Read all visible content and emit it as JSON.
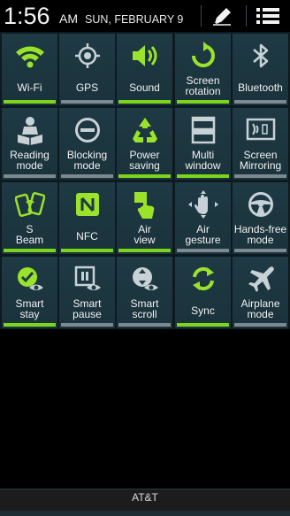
{
  "status": {
    "time": "1:56",
    "ampm": "AM",
    "date": "SUN, FEBRUARY 9"
  },
  "header_icons": {
    "edit": "pencil-icon",
    "list": "list-menu-icon"
  },
  "colors": {
    "active_green": "#7ad51c",
    "inactive_gray": "#7c8990",
    "tile_bg": "#1e3a44"
  },
  "quick_settings": [
    {
      "label": "Wi-Fi",
      "icon": "wifi-icon",
      "on": true
    },
    {
      "label": "GPS",
      "icon": "gps-icon",
      "on": false
    },
    {
      "label": "Sound",
      "icon": "sound-icon",
      "on": true
    },
    {
      "label": "Screen rotation",
      "icon": "screen-rotation-icon",
      "on": true
    },
    {
      "label": "Bluetooth",
      "icon": "bluetooth-icon",
      "on": false
    },
    {
      "label": "Reading mode",
      "icon": "reading-mode-icon",
      "on": false
    },
    {
      "label": "Blocking mode",
      "icon": "blocking-mode-icon",
      "on": false
    },
    {
      "label": "Power saving",
      "icon": "power-saving-icon",
      "on": true
    },
    {
      "label": "Multi window",
      "icon": "multi-window-icon",
      "on": true
    },
    {
      "label": "Screen Mirroring",
      "icon": "screen-mirroring-icon",
      "on": false
    },
    {
      "label": "S Beam",
      "icon": "s-beam-icon",
      "on": true
    },
    {
      "label": "NFC",
      "icon": "nfc-icon",
      "on": true
    },
    {
      "label": "Air view",
      "icon": "air-view-icon",
      "on": true
    },
    {
      "label": "Air gesture",
      "icon": "air-gesture-icon",
      "on": false
    },
    {
      "label": "Hands-free mode",
      "icon": "hands-free-mode-icon",
      "on": false
    },
    {
      "label": "Smart stay",
      "icon": "smart-stay-icon",
      "on": true
    },
    {
      "label": "Smart pause",
      "icon": "smart-pause-icon",
      "on": false
    },
    {
      "label": "Smart scroll",
      "icon": "smart-scroll-icon",
      "on": false
    },
    {
      "label": "Sync",
      "icon": "sync-icon",
      "on": true
    },
    {
      "label": "Airplane mode",
      "icon": "airplane-mode-icon",
      "on": false
    }
  ],
  "carrier": "AT&T"
}
